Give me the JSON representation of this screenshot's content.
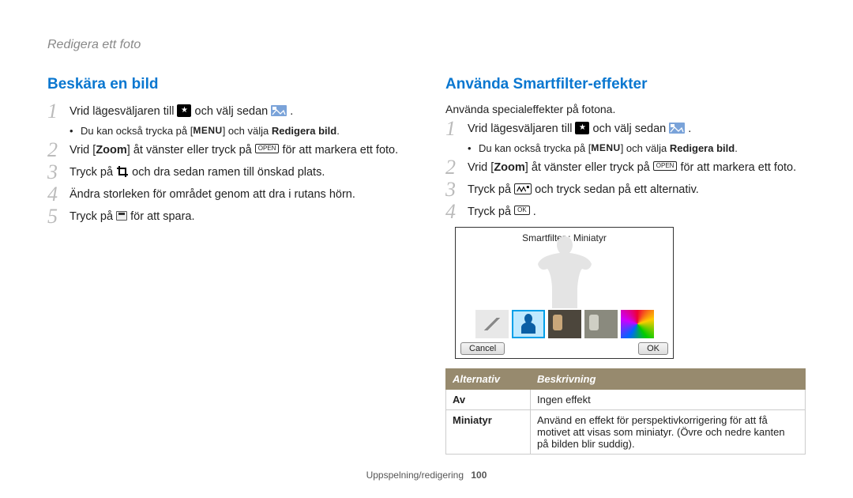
{
  "subtitle": "Redigera ett foto",
  "left": {
    "heading": "Beskära en bild",
    "step1_a": "Vrid lägesväljaren till ",
    "step1_b": " och välj sedan ",
    "step1_c": ".",
    "note1_a": "Du kan också trycka på [",
    "note1_menu": "MENU",
    "note1_b": "] och välja ",
    "note1_bold": "Redigera bild",
    "note1_c": ".",
    "step2_a": "Vrid [",
    "step2_zoom": "Zoom",
    "step2_b": "] åt vänster eller tryck på ",
    "step2_open": "OPEN",
    "step2_c": " för att markera ett foto.",
    "step3_a": "Tryck på ",
    "step3_b": " och dra sedan ramen till önskad plats.",
    "step4": "Ändra storleken för området genom att dra i rutans hörn.",
    "step5_a": "Tryck på ",
    "step5_b": " för att spara."
  },
  "right": {
    "heading": "Använda Smartfilter-effekter",
    "intro": "Använda specialeffekter på fotona.",
    "step1_a": "Vrid lägesväljaren till ",
    "step1_b": " och välj sedan ",
    "step1_c": ".",
    "note1_a": "Du kan också trycka på [",
    "note1_menu": "MENU",
    "note1_b": "] och välja ",
    "note1_bold": "Redigera bild",
    "note1_c": ".",
    "step2_a": "Vrid [",
    "step2_zoom": "Zoom",
    "step2_b": "] åt vänster eller tryck på ",
    "step2_open": "OPEN",
    "step2_c": " för att markera ett foto.",
    "step3_a": "Tryck på ",
    "step3_b": " och tryck sedan på ett alternativ.",
    "step4_a": "Tryck på ",
    "step4_ok": "OK",
    "step4_b": ".",
    "preview": {
      "top": "Smartfilter : Miniatyr",
      "cancel": "Cancel",
      "ok": "OK"
    },
    "table": {
      "h1": "Alternativ",
      "h2": "Beskrivning",
      "r1c1": "Av",
      "r1c2": "Ingen effekt",
      "r2c1": "Miniatyr",
      "r2c2": "Använd en effekt för perspektivkorrigering för att få motivet att visas som miniatyr. (Övre och nedre kanten på bilden blir suddig)."
    }
  },
  "footer": {
    "section": "Uppspelning/redigering",
    "page": "100"
  }
}
